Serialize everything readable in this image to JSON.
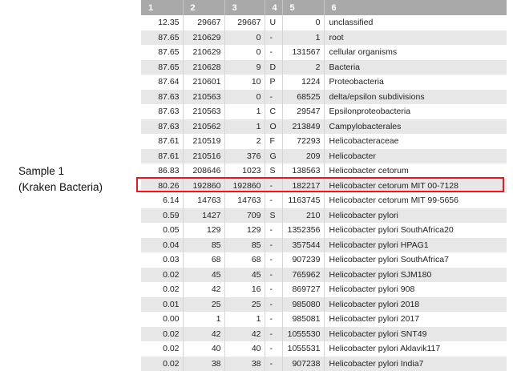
{
  "sample_label": {
    "line1": "Sample 1",
    "line2": "(Kraken Bacteria)"
  },
  "table": {
    "headers": [
      "1",
      "2",
      "3",
      "4",
      "5",
      "6"
    ],
    "highlighted_row": 11,
    "rows": [
      [
        "12.35",
        "29667",
        "29667",
        "U",
        "0",
        "unclassified"
      ],
      [
        "87.65",
        "210629",
        "0",
        "-",
        "1",
        "root"
      ],
      [
        "87.65",
        "210629",
        "0",
        "-",
        "131567",
        "cellular organisms"
      ],
      [
        "87.65",
        "210628",
        "9",
        "D",
        "2",
        "Bacteria"
      ],
      [
        "87.64",
        "210601",
        "10",
        "P",
        "1224",
        "Proteobacteria"
      ],
      [
        "87.63",
        "210563",
        "0",
        "-",
        "68525",
        "delta/epsilon subdivisions"
      ],
      [
        "87.63",
        "210563",
        "1",
        "C",
        "29547",
        "Epsilonproteobacteria"
      ],
      [
        "87.63",
        "210562",
        "1",
        "O",
        "213849",
        "Campylobacterales"
      ],
      [
        "87.61",
        "210519",
        "2",
        "F",
        "72293",
        "Helicobacteraceae"
      ],
      [
        "87.61",
        "210516",
        "376",
        "G",
        "209",
        "Helicobacter"
      ],
      [
        "86.83",
        "208646",
        "1023",
        "S",
        "138563",
        "Helicobacter cetorum"
      ],
      [
        "80.26",
        "192860",
        "192860",
        "-",
        "182217",
        "Helicobacter cetorum MIT 00-7128"
      ],
      [
        "6.14",
        "14763",
        "14763",
        "-",
        "1163745",
        "Helicobacter cetorum MIT 99-5656"
      ],
      [
        "0.59",
        "1427",
        "709",
        "S",
        "210",
        "Helicobacter pylori"
      ],
      [
        "0.05",
        "129",
        "129",
        "-",
        "1352356",
        "Helicobacter pylori SouthAfrica20"
      ],
      [
        "0.04",
        "85",
        "85",
        "-",
        "357544",
        "Helicobacter pylori HPAG1"
      ],
      [
        "0.03",
        "68",
        "68",
        "-",
        "907239",
        "Helicobacter pylori SouthAfrica7"
      ],
      [
        "0.02",
        "45",
        "45",
        "-",
        "765962",
        "Helicobacter pylori SJM180"
      ],
      [
        "0.02",
        "42",
        "16",
        "-",
        "869727",
        "Helicobacter pylori 908"
      ],
      [
        "0.01",
        "25",
        "25",
        "-",
        "985080",
        "Helicobacter pylori 2018"
      ],
      [
        "0.00",
        "1",
        "1",
        "-",
        "985081",
        "Helicobacter pylori 2017"
      ],
      [
        "0.02",
        "42",
        "42",
        "-",
        "1055530",
        "Helicobacter pylori SNT49"
      ],
      [
        "0.02",
        "40",
        "40",
        "-",
        "1055531",
        "Helicobacter pylori Aklavik117"
      ],
      [
        "0.02",
        "38",
        "38",
        "-",
        "907238",
        "Helicobacter pylori India7"
      ]
    ]
  },
  "colors": {
    "header_bg": "#a9a9a9",
    "row_alt_bg": "#e7e7e7",
    "highlight_border": "#e01b24"
  }
}
